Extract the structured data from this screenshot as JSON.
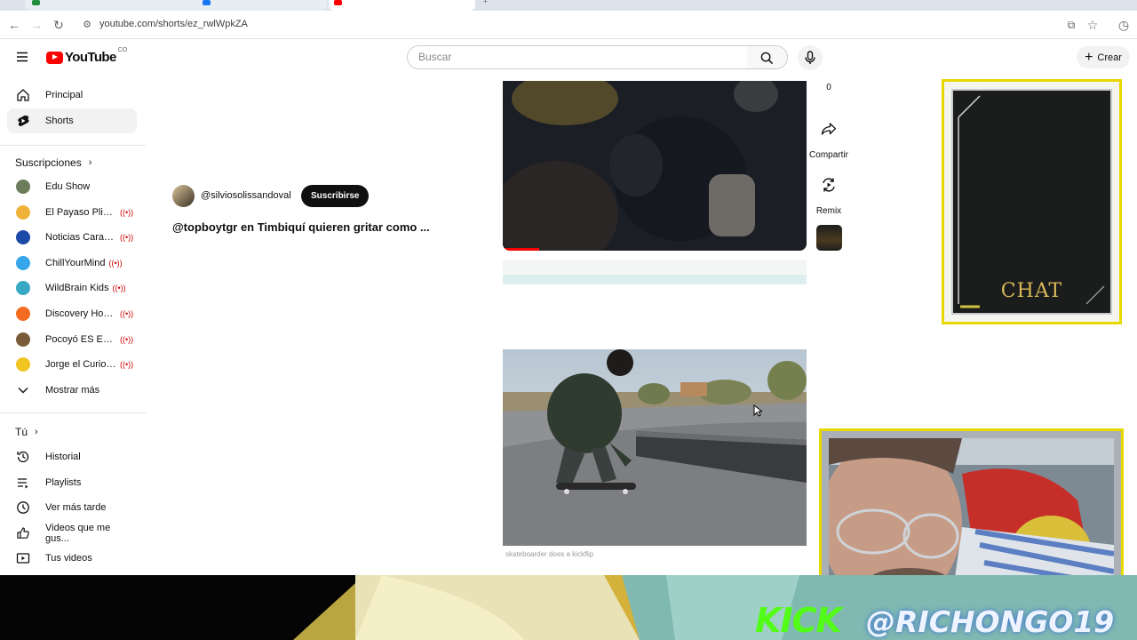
{
  "browser": {
    "url": "youtube.com/shorts/ez_rwlWpkZA"
  },
  "header": {
    "logo_text": "YouTube",
    "country_code": "CO",
    "search_placeholder": "Buscar",
    "create_label": "Crear"
  },
  "sidebar": {
    "main": [
      {
        "label": "Principal",
        "icon": "home-icon"
      },
      {
        "label": "Shorts",
        "icon": "shorts-icon"
      }
    ],
    "subscriptions_title": "Suscripciones",
    "subscriptions": [
      {
        "label": "Edu Show",
        "live": false,
        "color": "#6b7d5a"
      },
      {
        "label": "El Payaso Plim P...",
        "live": true,
        "color": "#f0b33a"
      },
      {
        "label": "Noticias Caracol",
        "live": true,
        "color": "#1b4aa6"
      },
      {
        "label": "ChillYourMind",
        "live": true,
        "color": "#35a6e8"
      },
      {
        "label": "WildBrain Kids",
        "live": true,
        "color": "#38a8c4"
      },
      {
        "label": "Discovery Home ...",
        "live": true,
        "color": "#f26b21"
      },
      {
        "label": "Pocoyó ES Españ...",
        "live": true,
        "color": "#7b5c3a"
      },
      {
        "label": "Jorge el Curioso ...",
        "live": true,
        "color": "#f2c422"
      }
    ],
    "show_more": "Mostrar más",
    "you_title": "Tú",
    "you": [
      {
        "label": "Historial",
        "icon": "history-icon"
      },
      {
        "label": "Playlists",
        "icon": "playlists-icon"
      },
      {
        "label": "Ver más tarde",
        "icon": "watch-later-icon"
      },
      {
        "label": "Videos que me gus...",
        "icon": "liked-icon"
      },
      {
        "label": "Tus videos",
        "icon": "your-videos-icon"
      }
    ]
  },
  "short": {
    "channel": "@silviosolissandoval",
    "subscribe_label": "Suscribirse",
    "title": "@topboytgr en Timbiquí quieren gritar como ...",
    "comments_count": "0",
    "share_label": "Compartir",
    "remix_label": "Remix",
    "progress": 0.12
  },
  "next_short": {
    "caption": "skateboarder does a kickflip"
  },
  "overlay": {
    "chat_label": "CHAT",
    "kick_label": "KICK",
    "handle": "@RICHONGO19"
  },
  "colors": {
    "yt_red": "#ff0000",
    "kick_green": "#53fc18",
    "frame_yellow": "#e8d800"
  }
}
